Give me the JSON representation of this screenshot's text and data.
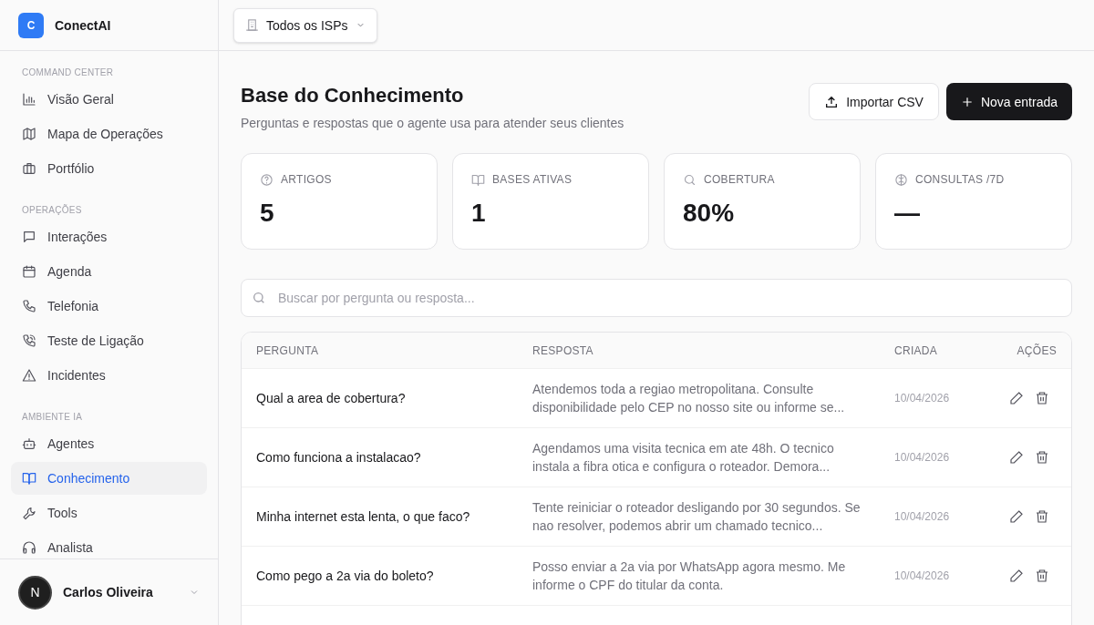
{
  "brand": {
    "initial": "C",
    "name": "ConectAI"
  },
  "sidebar": {
    "sections": [
      {
        "title": "COMMAND CENTER",
        "items": [
          {
            "label": "Visão Geral",
            "kind": "chart",
            "selected": false
          },
          {
            "label": "Mapa de Operações",
            "kind": "map",
            "selected": false
          },
          {
            "label": "Portfólio",
            "kind": "briefcase",
            "selected": false
          }
        ]
      },
      {
        "title": "OPERAÇÕES",
        "items": [
          {
            "label": "Interações",
            "kind": "message",
            "selected": false
          },
          {
            "label": "Agenda",
            "kind": "calendar",
            "selected": false
          },
          {
            "label": "Telefonia",
            "kind": "phone",
            "selected": false
          },
          {
            "label": "Teste de Ligação",
            "kind": "phonecall",
            "selected": false
          },
          {
            "label": "Incidentes",
            "kind": "alert",
            "selected": false
          }
        ]
      },
      {
        "title": "AMBIENTE IA",
        "items": [
          {
            "label": "Agentes",
            "kind": "bot",
            "selected": false
          },
          {
            "label": "Conhecimento",
            "kind": "book",
            "selected": true
          },
          {
            "label": "Tools",
            "kind": "wrench",
            "selected": false
          },
          {
            "label": "Analista",
            "kind": "headphones",
            "selected": false
          }
        ]
      }
    ]
  },
  "user": {
    "initial": "N",
    "name": "Carlos Oliveira"
  },
  "isp_selector": {
    "label": "Todos os ISPs"
  },
  "page": {
    "title": "Base do Conhecimento",
    "subtitle": "Perguntas e respostas que o agente usa para atender seus clientes"
  },
  "buttons": [
    {
      "label": "Importar CSV",
      "kind": "secondary"
    },
    {
      "label": "Nova entrada",
      "kind": "primary"
    }
  ],
  "stats": [
    {
      "label": "ARTIGOS",
      "value": "5",
      "kind": "help"
    },
    {
      "label": "BASES ATIVAS",
      "value": "1",
      "kind": "book"
    },
    {
      "label": "COBERTURA",
      "value": "80%",
      "kind": "search"
    },
    {
      "label": "CONSULTAS /7D",
      "value": "—",
      "kind": "brain"
    }
  ],
  "search": {
    "placeholder": "Buscar por pergunta ou resposta..."
  },
  "table": {
    "columns": [
      "PERGUNTA",
      "RESPOSTA",
      "CRIADA",
      "AÇÕES"
    ],
    "rows": [
      {
        "question": "Qual a area de cobertura?",
        "answer": "Atendemos toda a regiao metropolitana. Consulte disponibilidade pelo CEP no nosso site ou informe se...",
        "created": "10/04/2026"
      },
      {
        "question": "Como funciona a instalacao?",
        "answer": "Agendamos uma visita tecnica em ate 48h. O tecnico instala a fibra otica e configura o roteador. Demora...",
        "created": "10/04/2026"
      },
      {
        "question": "Minha internet esta lenta, o que faco?",
        "answer": "Tente reiniciar o roteador desligando por 30 segundos. Se nao resolver, podemos abrir um chamado tecnico...",
        "created": "10/04/2026"
      },
      {
        "question": "Como pego a 2a via do boleto?",
        "answer": "Posso enviar a 2a via por WhatsApp agora mesmo. Me informe o CPF do titular da conta.",
        "created": "10/04/2026"
      }
    ]
  }
}
